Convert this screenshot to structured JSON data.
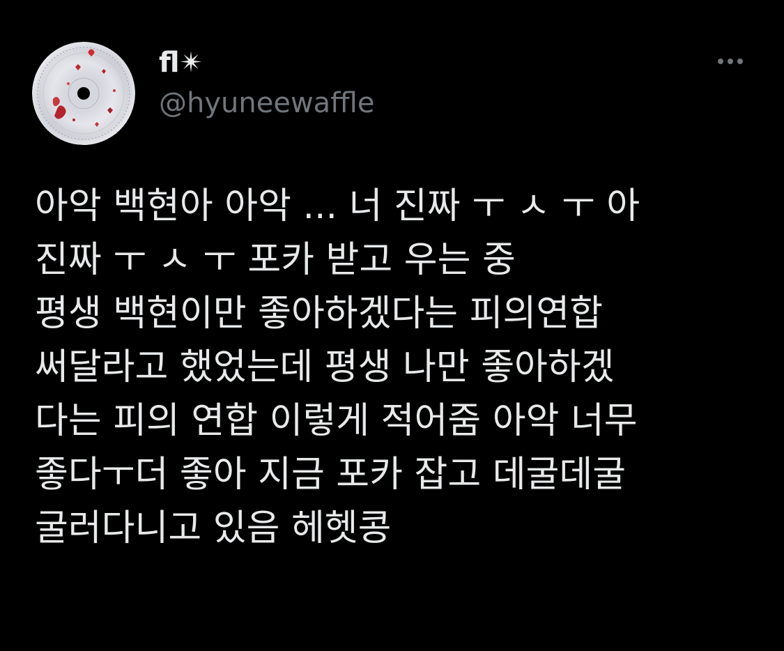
{
  "theme": {
    "background": "#000000",
    "text": "#e7e9ea",
    "secondary_text": "#71767b"
  },
  "author": {
    "display_name": "fl✴︎",
    "handle": "@hyuneewaffle",
    "avatar_icon": "cd-disc-avatar-icon"
  },
  "actions": {
    "more_icon": "more-dots-icon"
  },
  "tweet": {
    "lines": [
      "아악 백현아 아악 ... 너 진짜 ㅜ ㅅ ㅜ 아",
      "진짜 ㅜ ㅅ ㅜ 포카 받고 우는 중",
      "평생 백현이만 좋아하겠다는 피의연합",
      "써달라고 했었는데 평생 나만 좋아하겠",
      "다는 피의 연합 이렇게 적어줌 아악 너무",
      "좋다ㅜ더 좋아 지금 포카 잡고 데굴데굴",
      "굴러다니고 있음 헤헷콩"
    ]
  }
}
